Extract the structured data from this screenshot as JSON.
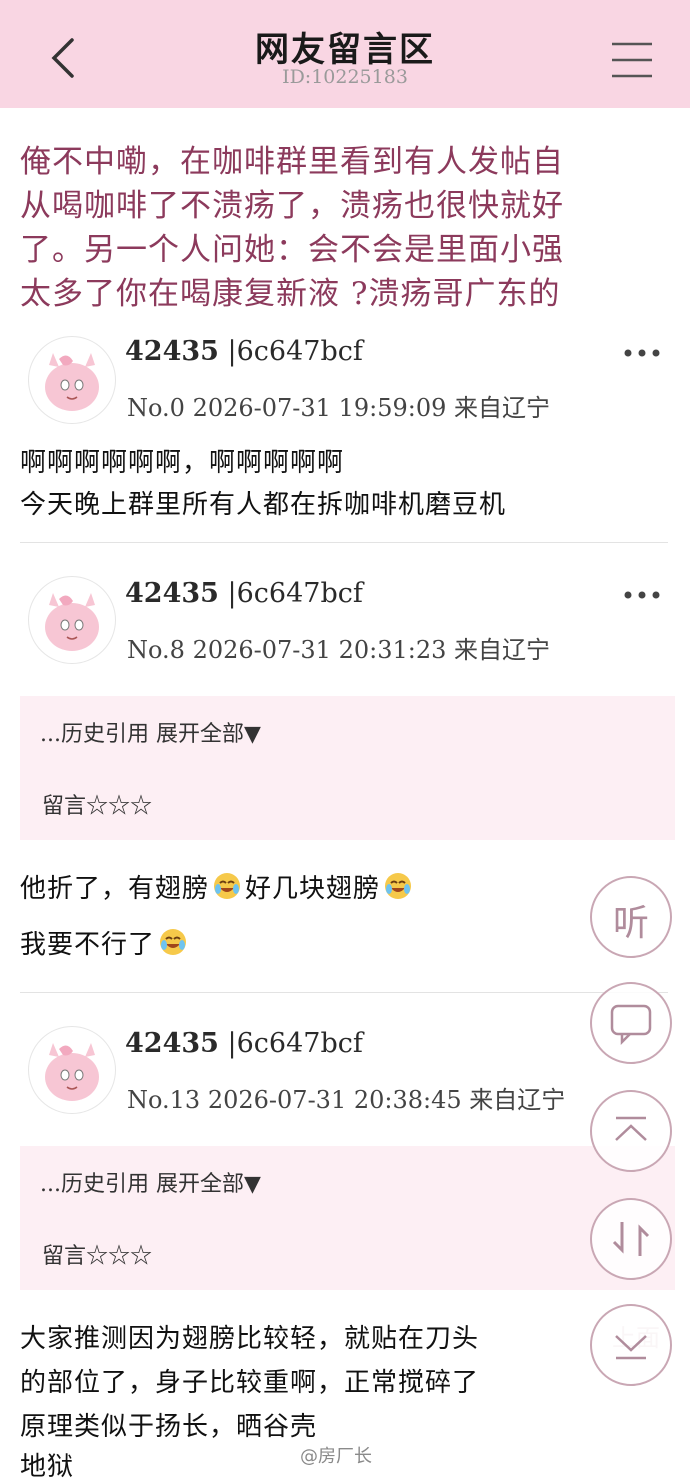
{
  "header": {
    "title": "网友留言区",
    "thread_id": "ID:10225183"
  },
  "topic": {
    "lines": [
      "俺不中嘞，在咖啡群里看到有人发帖自",
      "从喝咖啡了不溃疡了，溃疡也很快就好",
      "了。另一个人问她：会不会是里面小强",
      "太多了你在喝康复新液 ?溃疡哥广东的"
    ],
    "color": "#8c3a5c"
  },
  "posts": [
    {
      "user_num": "42435",
      "user_hash": "|6c647bcf",
      "floor": "No.0",
      "datetime": "2026-07-31 19:59:09",
      "location": "来自辽宁",
      "body": [
        "啊啊啊啊啊啊，啊啊啊啊啊",
        "今天晚上群里所有人都在拆咖啡机磨豆机"
      ]
    },
    {
      "user_num": "42435",
      "user_hash": "|6c647bcf",
      "floor": "No.8",
      "datetime": "2026-07-31 20:31:23",
      "location": "来自辽宁",
      "quote_expand": "...历史引用 展开全部▼",
      "quote_label": "留言☆☆☆",
      "body_parts": [
        "他折了，有翅膀",
        "好几块翅膀"
      ],
      "body_line2": "我要不行了"
    },
    {
      "user_num": "42435",
      "user_hash": "|6c647bcf",
      "floor": "No.13",
      "datetime": "2026-07-31 20:38:45",
      "location": "来自辽宁",
      "quote_expand": "...历史引用 展开全部▼",
      "quote_label": "留言☆☆☆",
      "body": [
        "大家推测因为翅膀比较轻，就贴在刀头",
        "的部位了，身子比较重啊，正常搅碎了",
        "原理类似于扬长，晒谷壳",
        "地狱"
      ]
    }
  ],
  "float_buttons": {
    "listen": "听",
    "ghost_text": "上面"
  },
  "icons": [
    "back-arrow-icon",
    "menu-icon",
    "more-dots-icon",
    "avatar-jigglypuff-icon",
    "crying-laughing-emoji-icon",
    "comment-icon",
    "scroll-top-icon",
    "swap-icon",
    "scroll-bottom-icon"
  ],
  "watermark": "@房厂长",
  "colors": {
    "header_bg": "#f9d6e3",
    "quote_bg": "#fdeff4",
    "accent": "#8c3a5c"
  }
}
